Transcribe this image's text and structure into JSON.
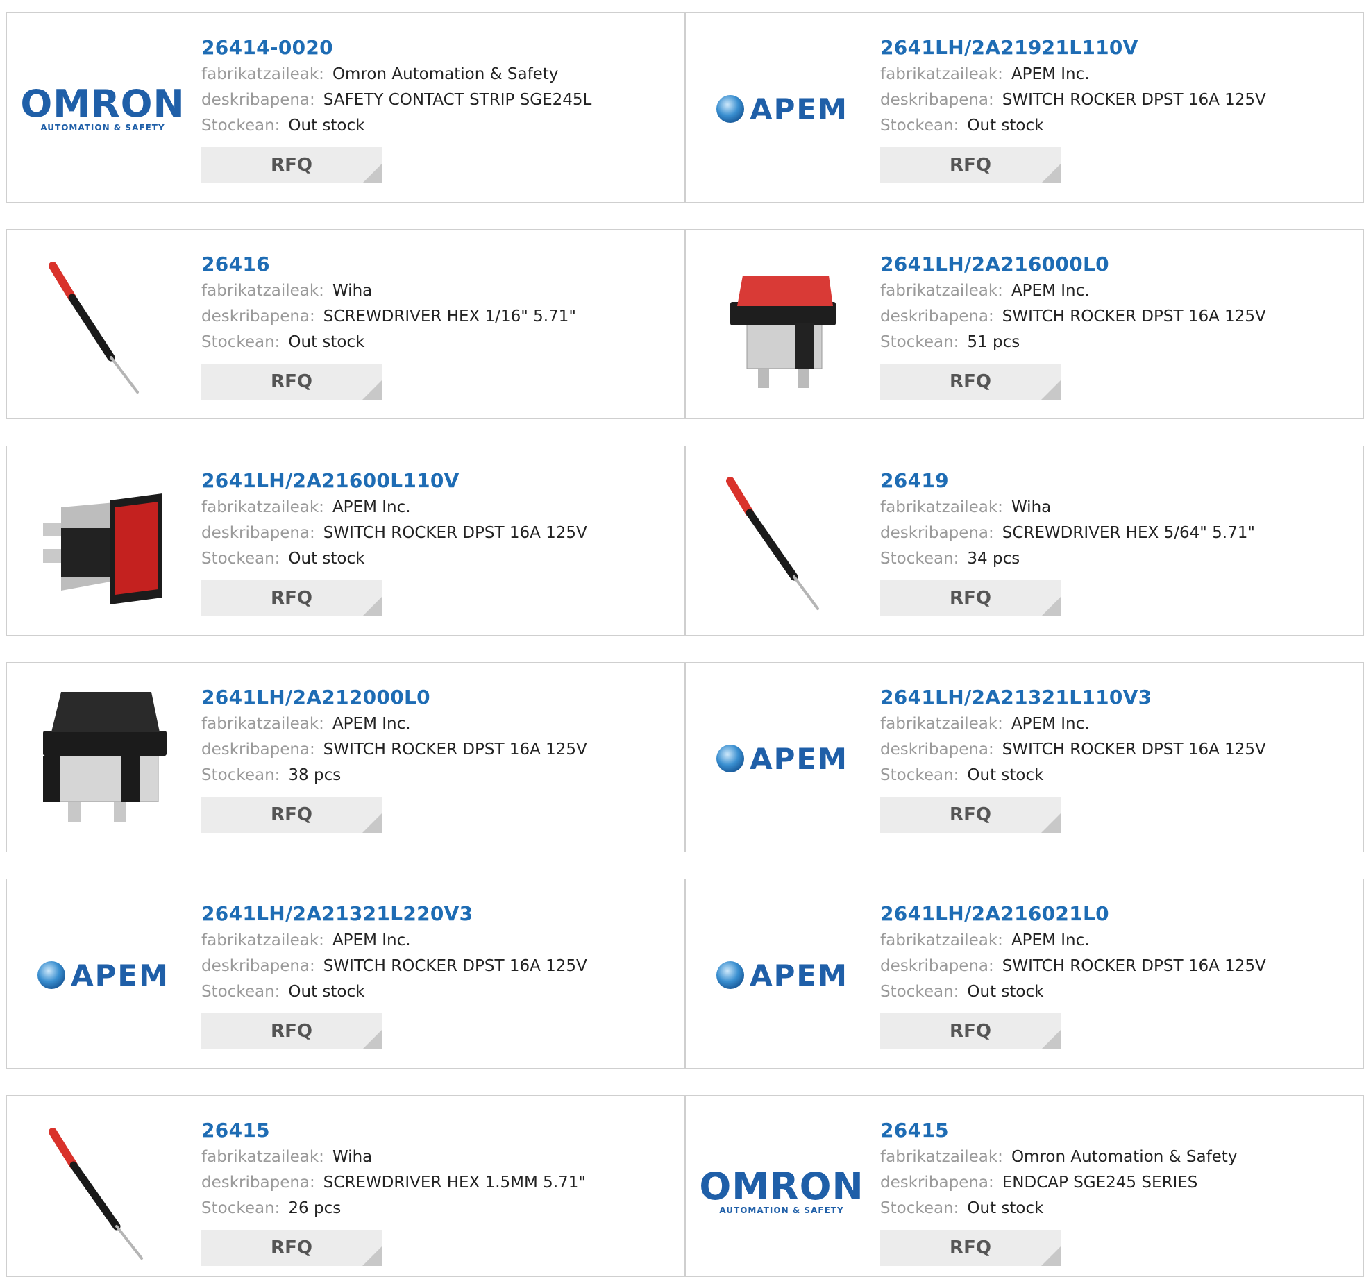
{
  "labels": {
    "manufacturer": "fabrikatzaileak:",
    "description": "deskribapena:",
    "stock": "Stockean:",
    "rfq": "RFQ"
  },
  "colors": {
    "link": "#1e6cb4",
    "label": "#9a9a9a",
    "button_bg": "#ececec"
  },
  "products": [
    {
      "pn": "26414-0020",
      "manufacturer": "Omron Automation & Safety",
      "description": "SAFETY CONTACT STRIP SGE245L",
      "stock": "Out stock",
      "image": "omron-logo",
      "logo_text": "OMRON",
      "logo_sub": "AUTOMATION & SAFETY"
    },
    {
      "pn": "2641LH/2A21921L110V",
      "manufacturer": "APEM Inc.",
      "description": "SWITCH ROCKER DPST 16A 125V",
      "stock": "Out stock",
      "image": "apem-logo",
      "logo_text": "APEM"
    },
    {
      "pn": "26416",
      "manufacturer": "Wiha",
      "description": "SCREWDRIVER HEX 1/16\" 5.71\"",
      "stock": "Out stock",
      "image": "screwdriver-photo"
    },
    {
      "pn": "2641LH/2A216000L0",
      "manufacturer": "APEM Inc.",
      "description": "SWITCH ROCKER DPST 16A 125V",
      "stock": "51 pcs",
      "image": "red-rocker-switch-photo"
    },
    {
      "pn": "2641LH/2A21600L110V",
      "manufacturer": "APEM Inc.",
      "description": "SWITCH ROCKER DPST 16A 125V",
      "stock": "Out stock",
      "image": "red-rocker-switch-side-photo"
    },
    {
      "pn": "26419",
      "manufacturer": "Wiha",
      "description": "SCREWDRIVER HEX 5/64\" 5.71\"",
      "stock": "34 pcs",
      "image": "screwdriver-photo"
    },
    {
      "pn": "2641LH/2A212000L0",
      "manufacturer": "APEM Inc.",
      "description": "SWITCH ROCKER DPST 16A 125V",
      "stock": "38 pcs",
      "image": "black-rocker-switch-photo"
    },
    {
      "pn": "2641LH/2A21321L110V3",
      "manufacturer": "APEM Inc.",
      "description": "SWITCH ROCKER DPST 16A 125V",
      "stock": "Out stock",
      "image": "apem-logo",
      "logo_text": "APEM"
    },
    {
      "pn": "2641LH/2A21321L220V3",
      "manufacturer": "APEM Inc.",
      "description": "SWITCH ROCKER DPST 16A 125V",
      "stock": "Out stock",
      "image": "apem-logo",
      "logo_text": "APEM"
    },
    {
      "pn": "2641LH/2A216021L0",
      "manufacturer": "APEM Inc.",
      "description": "SWITCH ROCKER DPST 16A 125V",
      "stock": "Out stock",
      "image": "apem-logo",
      "logo_text": "APEM"
    },
    {
      "pn": "26415",
      "manufacturer": "Wiha",
      "description": "SCREWDRIVER HEX 1.5MM 5.71\"",
      "stock": "26 pcs",
      "image": "screwdriver-photo"
    },
    {
      "pn": "26415",
      "manufacturer": "Omron Automation & Safety",
      "description": "ENDCAP SGE245 SERIES",
      "stock": "Out stock",
      "image": "omron-logo",
      "logo_text": "OMRON",
      "logo_sub": "AUTOMATION & SAFETY"
    }
  ]
}
